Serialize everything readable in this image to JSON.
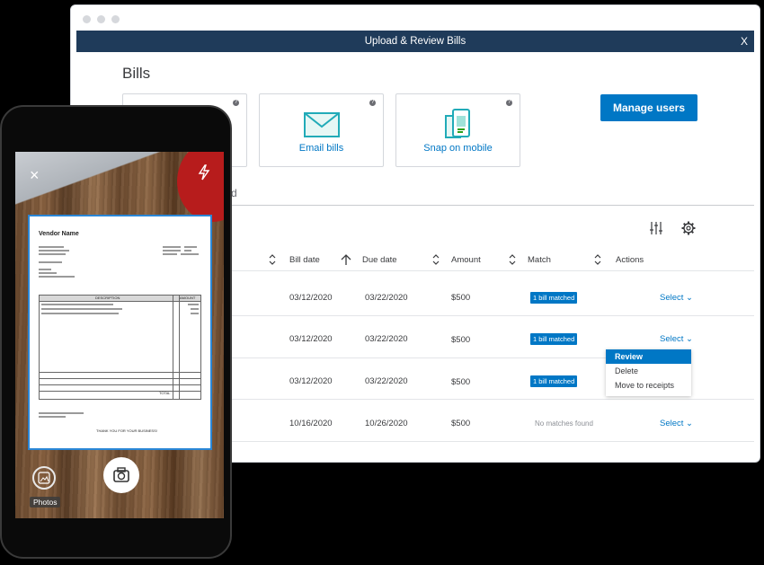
{
  "window": {
    "title": "Upload & Review Bills",
    "close_label": "X"
  },
  "page": {
    "title": "Bills"
  },
  "cards": [
    {
      "label": "",
      "help": "?"
    },
    {
      "label": "Email bills",
      "help": "?",
      "icon": "email-icon"
    },
    {
      "label": "Snap on mobile",
      "help": "?",
      "icon": "mobile-snap-icon"
    }
  ],
  "manage_users_label": "Manage users",
  "tab_fragment": "d",
  "table": {
    "headers": {
      "bill_date": "Bill date",
      "due_date": "Due date",
      "amount": "Amount",
      "match": "Match",
      "actions": "Actions"
    },
    "rows": [
      {
        "bill_date": "03/12/2020",
        "due_date": "03/22/2020",
        "amount": "$500",
        "match": "1 bill matched",
        "action": "Select"
      },
      {
        "bill_date": "03/12/2020",
        "due_date": "03/22/2020",
        "amount": "$500",
        "match": "1 bill matched",
        "action": "Select"
      },
      {
        "bill_date": "03/12/2020",
        "due_date": "03/22/2020",
        "amount": "$500",
        "match": "1 bill matched",
        "action": ""
      },
      {
        "bill_date": "10/16/2020",
        "due_date": "10/26/2020",
        "amount": "$500",
        "match": "No matches found",
        "action": "Select"
      }
    ]
  },
  "dropdown": {
    "items": [
      "Review",
      "Delete",
      "Move to receipts"
    ]
  },
  "phone": {
    "close_label": "×",
    "photos_label": "Photos",
    "document": {
      "vendor_name": "Vendor Name",
      "table_header": "DESCRIPTION",
      "amount_header": "AMOUNT",
      "total_label": "TOTAL",
      "thanks": "THANK YOU FOR YOUR BUSINESS!"
    }
  },
  "colors": {
    "accent": "#0077c5",
    "titlebar": "#1f3b5a"
  }
}
